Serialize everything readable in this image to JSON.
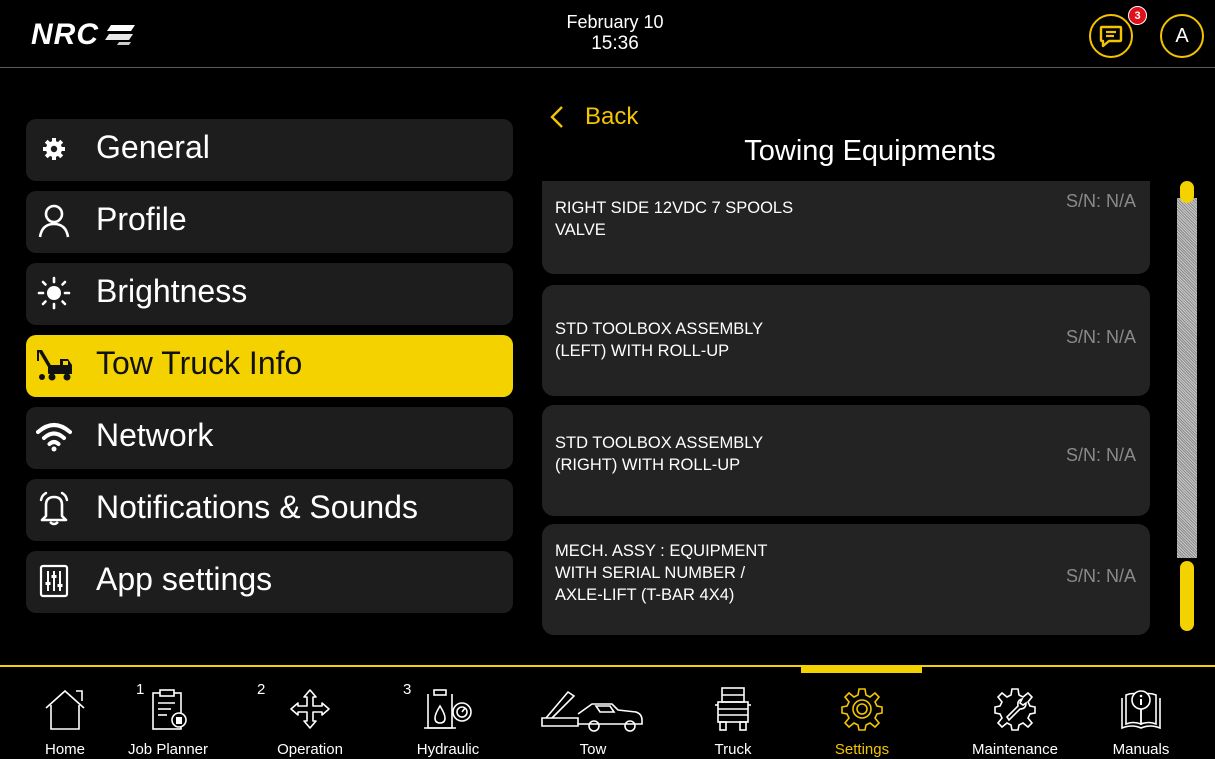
{
  "header": {
    "logo_text": "NRC",
    "date": "February 10",
    "time": "15:36",
    "messages_badge": "3",
    "avatar_initial": "A"
  },
  "menu": {
    "items": [
      {
        "label": "General",
        "icon": "gear-icon",
        "active": false
      },
      {
        "label": "Profile",
        "icon": "person-icon",
        "active": false
      },
      {
        "label": "Brightness",
        "icon": "sun-icon",
        "active": false
      },
      {
        "label": "Tow Truck Info",
        "icon": "tow-truck-icon",
        "active": true
      },
      {
        "label": "Network",
        "icon": "wifi-icon",
        "active": false
      },
      {
        "label": "Notifications & Sounds",
        "icon": "bell-icon",
        "active": false
      },
      {
        "label": "App settings",
        "icon": "sliders-icon",
        "active": false
      }
    ]
  },
  "panel": {
    "back_label": "Back",
    "title": "Towing Equipments",
    "items": [
      {
        "name_lines": [
          "RIGHT SIDE 12VDC 7 SPOOLS",
          "VALVE"
        ],
        "sn": "S/N: N/A"
      },
      {
        "name_lines": [
          "STD TOOLBOX ASSEMBLY",
          "(LEFT) WITH ROLL-UP"
        ],
        "sn": "S/N: N/A"
      },
      {
        "name_lines": [
          "STD TOOLBOX ASSEMBLY",
          "(RIGHT) WITH ROLL-UP"
        ],
        "sn": "S/N: N/A"
      },
      {
        "name_lines": [
          "MECH. ASSY : EQUIPMENT",
          "WITH SERIAL NUMBER /",
          "AXLE-LIFT (T-BAR 4X4)"
        ],
        "sn": "S/N: N/A"
      }
    ]
  },
  "nav": {
    "items": [
      {
        "label": "Home",
        "icon": "home-icon",
        "num": ""
      },
      {
        "label": "Job Planner",
        "icon": "job-planner-icon",
        "num": "1"
      },
      {
        "label": "Operation",
        "icon": "move-arrows-icon",
        "num": "2"
      },
      {
        "label": "Hydraulic",
        "icon": "hydraulic-icon",
        "num": "3"
      },
      {
        "label": "Tow",
        "icon": "tow-icon",
        "num": ""
      },
      {
        "label": "Truck",
        "icon": "truck-icon",
        "num": ""
      },
      {
        "label": "Settings",
        "icon": "settings-gear-icon",
        "num": "",
        "active": true
      },
      {
        "label": "Maintenance",
        "icon": "maintenance-icon",
        "num": ""
      },
      {
        "label": "Manuals",
        "icon": "manuals-icon",
        "num": ""
      }
    ]
  },
  "colors": {
    "accent": "#f3d200",
    "badge": "#e0101b",
    "card": "#232323",
    "serial": "#8a8a8a"
  }
}
